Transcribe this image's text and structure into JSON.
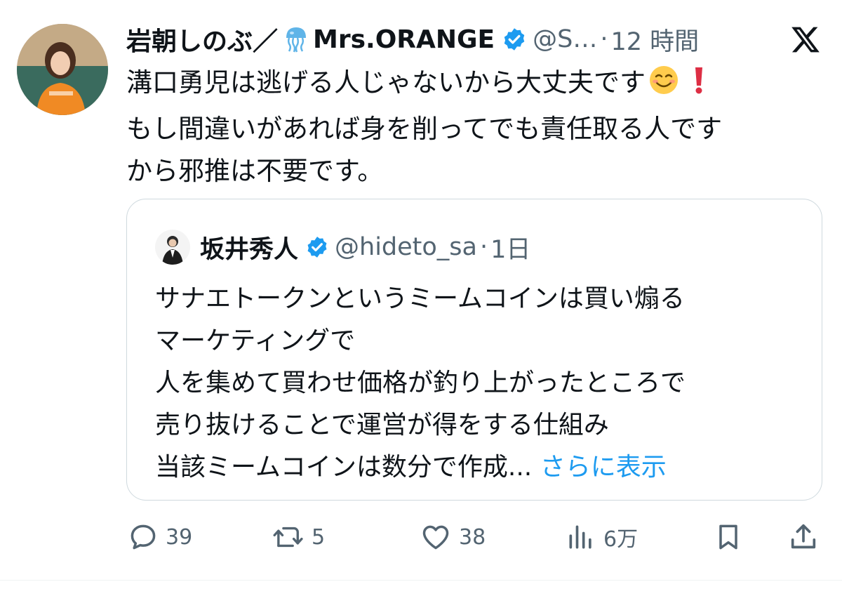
{
  "post": {
    "author_name": "岩朝しのぶ／",
    "author_name_suffix": "Mrs.ORANGE",
    "handle": "@S…",
    "time_sep": "·",
    "time": "12 時間",
    "body_lines": [
      "溝口勇児は逃げる人じゃないから大丈夫です",
      "もし間違いがあれば身を削ってでも責任取る人です",
      "から邪推は不要です。"
    ]
  },
  "quote": {
    "author_name": "坂井秀人",
    "handle": "@hideto_sa",
    "time_sep": "·",
    "time": "1日",
    "lines": [
      "サナエトークンというミームコインは買い煽る",
      "マーケティングで",
      "人を集めて買わせ価格が釣り上がったところで",
      "売り抜けることで運営が得をする仕組み",
      "当該ミームコインは数分で作成..."
    ],
    "show_more": "さらに表示"
  },
  "actions": {
    "replies": "39",
    "reposts": "5",
    "likes": "38",
    "views": "6万"
  },
  "icons": {
    "jellyfish": "jellyfish-emoji-icon",
    "verified": "verified-badge-icon",
    "x_logo": "x-logo-icon",
    "smile": "smiling-face-emoji-icon",
    "exclamation": "red-exclamation-emoji-icon",
    "reply": "reply-icon",
    "repost": "repost-icon",
    "like": "heart-icon",
    "views": "views-icon",
    "bookmark": "bookmark-icon",
    "share": "share-icon"
  },
  "colors": {
    "verified": "#1d9bf0",
    "link": "#1d9bf0",
    "secondary_text": "#536471",
    "border": "#cfd9de"
  }
}
